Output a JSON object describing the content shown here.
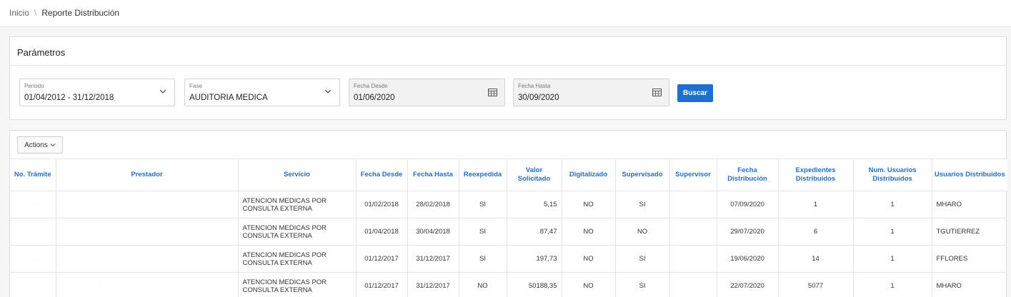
{
  "breadcrumb": {
    "home": "Inicio",
    "separator": "\\",
    "current": "Reporte Distribución"
  },
  "parameters": {
    "title": "Parámetros",
    "periodo": {
      "label": "Periodo",
      "value": "01/04/2012 - 31/12/2018"
    },
    "fase": {
      "label": "Fase",
      "value": "AUDITORIA MEDICA"
    },
    "fecha_desde": {
      "label": "Fecha Desde",
      "value": "01/06/2020"
    },
    "fecha_hasta": {
      "label": "Fecha Hasta",
      "value": "30/09/2020"
    },
    "buscar_label": "Buscar"
  },
  "report": {
    "actions_label": "Actions",
    "columns": [
      "No. Trámite",
      "Prestador",
      "Servicio",
      "Fecha Desde",
      "Fecha Hasta",
      "Reexpedida",
      "Valor Solicitado",
      "Digitalizado",
      "Supervisado",
      "Supervisor",
      "Fecha Distribución",
      "Expedientes Distribuidos",
      "Num. Usuarios Distribuidos",
      "Usuarios Distribuidos"
    ],
    "rows": [
      {
        "servicio": "ATENCION MEDICAS POR CONSULTA EXTERNA",
        "fecha_desde": "01/02/2018",
        "fecha_hasta": "28/02/2018",
        "reexpedida": "SI",
        "valor": "5,15",
        "digitalizado": "NO",
        "supervisado": "SI",
        "fecha_distribucion": "07/09/2020",
        "expedientes": "1",
        "num_usuarios": "1",
        "usuarios": "MHARO"
      },
      {
        "servicio": "ATENCION MEDICAS POR CONSULTA EXTERNA",
        "fecha_desde": "01/04/2018",
        "fecha_hasta": "30/04/2018",
        "reexpedida": "SI",
        "valor": "87,47",
        "digitalizado": "NO",
        "supervisado": "NO",
        "fecha_distribucion": "29/07/2020",
        "expedientes": "6",
        "num_usuarios": "1",
        "usuarios": "TGUTIERREZ"
      },
      {
        "servicio": "ATENCION MEDICAS POR CONSULTA EXTERNA",
        "fecha_desde": "01/12/2017",
        "fecha_hasta": "31/12/2017",
        "reexpedida": "SI",
        "valor": "197,73",
        "digitalizado": "NO",
        "supervisado": "SI",
        "fecha_distribucion": "19/06/2020",
        "expedientes": "14",
        "num_usuarios": "1",
        "usuarios": "FFLORES"
      },
      {
        "servicio": "ATENCION MEDICAS POR CONSULTA EXTERNA",
        "fecha_desde": "01/12/2017",
        "fecha_hasta": "31/12/2017",
        "reexpedida": "NO",
        "valor": "50188,35",
        "digitalizado": "NO",
        "supervisado": "SI",
        "fecha_distribucion": "22/07/2020",
        "expedientes": "5077",
        "num_usuarios": "1",
        "usuarios": "MHARO"
      }
    ]
  },
  "colors": {
    "accent": "#1f6fd0",
    "header_text": "#1f6fd0",
    "border": "#e4e4e4"
  },
  "icons": {
    "dropdown": "chevron-down-icon",
    "calendar": "calendar-icon"
  }
}
